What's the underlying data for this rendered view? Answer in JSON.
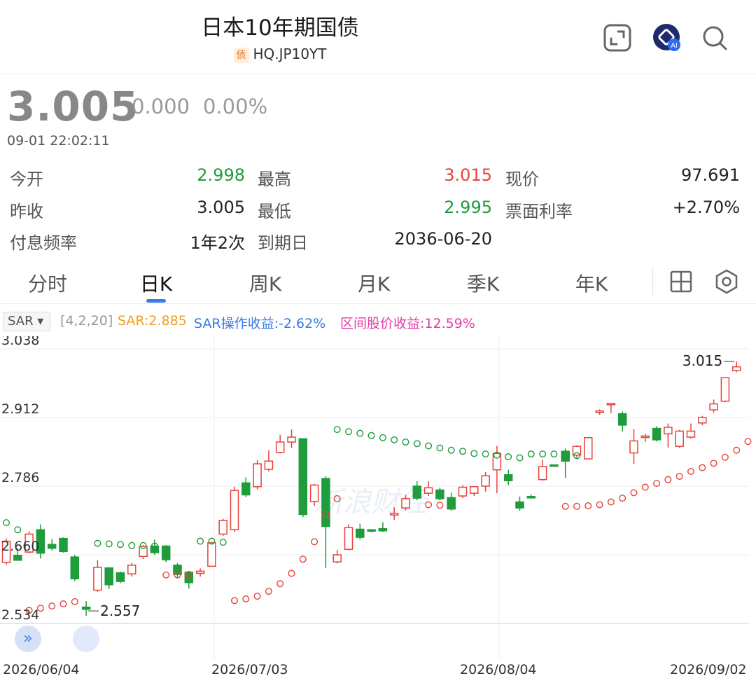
{
  "header": {
    "title": "日本10年期国债",
    "bond_tag": "债",
    "code": "HQ.JP10YT",
    "icons": [
      "expand-icon",
      "ai-assistant-icon",
      "search-icon"
    ]
  },
  "quote": {
    "price": "3.005",
    "change": "0.000",
    "change_pct": "0.00%",
    "timestamp": "09-01 22:02:11",
    "rows": [
      [
        {
          "label": "今开",
          "value": "2.998"
        },
        {
          "label": "最高",
          "value": "3.015"
        },
        {
          "label": "现价",
          "value": "97.691"
        }
      ],
      [
        {
          "label": "昨收",
          "value": "3.005"
        },
        {
          "label": "最低",
          "value": "2.995"
        },
        {
          "label": "票面利率",
          "value": "+2.70%"
        }
      ],
      [
        {
          "label": "付息频率",
          "value": "1年2次"
        },
        {
          "label": "到期日",
          "value": "2036-06-20"
        }
      ]
    ]
  },
  "tabs": [
    "分时",
    "日K",
    "周K",
    "月K",
    "季K",
    "年K"
  ],
  "active_tab": "日K",
  "indicator": {
    "name": "SAR ▾",
    "params": "[4,2,20]",
    "sar": "SAR:2.885",
    "op_return": "SAR操作收益:-2.62%",
    "range_return": "区间股价收益:12.59%"
  },
  "colors": {
    "up": "#e8423b",
    "down": "#1f9c3b",
    "sar_up": "#e8423b",
    "sar_down": "#1f9c3b"
  },
  "chart_data": {
    "type": "candlestick",
    "y_ticks": [
      "3.038",
      "2.912",
      "2.786",
      "2.660",
      "2.534"
    ],
    "ylim": [
      2.534,
      3.038
    ],
    "x_labels": [
      "2026/06/04",
      "2026/07/03",
      "2026/08/04",
      "2026/09/02"
    ],
    "max_label": "3.015",
    "min_label": "2.557",
    "watermark": "新浪财经",
    "candles": [
      {
        "o": 2.646,
        "h": 2.69,
        "l": 2.642,
        "c": 2.685
      },
      {
        "o": 2.659,
        "h": 2.672,
        "l": 2.65,
        "c": 2.65
      },
      {
        "o": 2.665,
        "h": 2.703,
        "l": 2.663,
        "c": 2.698
      },
      {
        "o": 2.706,
        "h": 2.716,
        "l": 2.653,
        "c": 2.663
      },
      {
        "o": 2.679,
        "h": 2.689,
        "l": 2.668,
        "c": 2.672
      },
      {
        "o": 2.69,
        "h": 2.692,
        "l": 2.664,
        "c": 2.666
      },
      {
        "o": 2.656,
        "h": 2.66,
        "l": 2.612,
        "c": 2.616
      },
      {
        "o": 2.564,
        "h": 2.575,
        "l": 2.548,
        "c": 2.56
      },
      {
        "o": 2.595,
        "h": 2.65,
        "l": 2.592,
        "c": 2.637
      },
      {
        "o": 2.636,
        "h": 2.637,
        "l": 2.597,
        "c": 2.605
      },
      {
        "o": 2.627,
        "h": 2.629,
        "l": 2.608,
        "c": 2.611
      },
      {
        "o": 2.625,
        "h": 2.645,
        "l": 2.62,
        "c": 2.641
      },
      {
        "o": 2.657,
        "h": 2.678,
        "l": 2.652,
        "c": 2.675
      },
      {
        "o": 2.676,
        "h": 2.688,
        "l": 2.66,
        "c": 2.664
      },
      {
        "o": 2.676,
        "h": 2.678,
        "l": 2.647,
        "c": 2.651
      },
      {
        "o": 2.641,
        "h": 2.645,
        "l": 2.617,
        "c": 2.624
      },
      {
        "o": 2.628,
        "h": 2.629,
        "l": 2.598,
        "c": 2.609
      },
      {
        "o": 2.626,
        "h": 2.635,
        "l": 2.62,
        "c": 2.63
      },
      {
        "o": 2.639,
        "h": 2.684,
        "l": 2.638,
        "c": 2.682
      },
      {
        "o": 2.698,
        "h": 2.726,
        "l": 2.695,
        "c": 2.723
      },
      {
        "o": 2.706,
        "h": 2.785,
        "l": 2.702,
        "c": 2.778
      },
      {
        "o": 2.792,
        "h": 2.802,
        "l": 2.766,
        "c": 2.77
      },
      {
        "o": 2.785,
        "h": 2.834,
        "l": 2.78,
        "c": 2.827
      },
      {
        "o": 2.817,
        "h": 2.852,
        "l": 2.813,
        "c": 2.832
      },
      {
        "o": 2.848,
        "h": 2.88,
        "l": 2.846,
        "c": 2.867
      },
      {
        "o": 2.867,
        "h": 2.89,
        "l": 2.856,
        "c": 2.876
      },
      {
        "o": 2.873,
        "h": 2.874,
        "l": 2.729,
        "c": 2.734
      },
      {
        "o": 2.758,
        "h": 2.79,
        "l": 2.75,
        "c": 2.788
      },
      {
        "o": 2.8,
        "h": 2.804,
        "l": 2.636,
        "c": 2.712
      },
      {
        "o": 2.647,
        "h": 2.669,
        "l": 2.644,
        "c": 2.66
      },
      {
        "o": 2.67,
        "h": 2.716,
        "l": 2.668,
        "c": 2.71
      },
      {
        "o": 2.707,
        "h": 2.717,
        "l": 2.688,
        "c": 2.692
      },
      {
        "o": 2.706,
        "h": 2.707,
        "l": 2.701,
        "c": 2.705
      },
      {
        "o": 2.708,
        "h": 2.72,
        "l": 2.702,
        "c": 2.704
      },
      {
        "o": 2.733,
        "h": 2.747,
        "l": 2.724,
        "c": 2.736
      },
      {
        "o": 2.746,
        "h": 2.77,
        "l": 2.742,
        "c": 2.763
      },
      {
        "o": 2.786,
        "h": 2.795,
        "l": 2.76,
        "c": 2.764
      },
      {
        "o": 2.773,
        "h": 2.795,
        "l": 2.768,
        "c": 2.783
      },
      {
        "o": 2.779,
        "h": 2.783,
        "l": 2.76,
        "c": 2.763
      },
      {
        "o": 2.765,
        "h": 2.774,
        "l": 2.741,
        "c": 2.744
      },
      {
        "o": 2.768,
        "h": 2.788,
        "l": 2.764,
        "c": 2.784
      },
      {
        "o": 2.773,
        "h": 2.78,
        "l": 2.768,
        "c": 2.785
      },
      {
        "o": 2.786,
        "h": 2.812,
        "l": 2.776,
        "c": 2.805
      },
      {
        "o": 2.816,
        "h": 2.86,
        "l": 2.773,
        "c": 2.846
      },
      {
        "o": 2.807,
        "h": 2.816,
        "l": 2.788,
        "c": 2.796
      },
      {
        "o": 2.757,
        "h": 2.767,
        "l": 2.741,
        "c": 2.746
      },
      {
        "o": 2.767,
        "h": 2.771,
        "l": 2.763,
        "c": 2.766
      },
      {
        "o": 2.798,
        "h": 2.835,
        "l": 2.796,
        "c": 2.822
      },
      {
        "o": 2.825,
        "h": 2.826,
        "l": 2.822,
        "c": 2.823
      },
      {
        "o": 2.85,
        "h": 2.855,
        "l": 2.801,
        "c": 2.832
      },
      {
        "o": 2.843,
        "h": 2.861,
        "l": 2.838,
        "c": 2.859
      },
      {
        "o": 2.836,
        "h": 2.874,
        "l": 2.835,
        "c": 2.875
      },
      {
        "o": 2.922,
        "h": 2.927,
        "l": 2.917,
        "c": 2.924
      },
      {
        "o": 2.938,
        "h": 2.939,
        "l": 2.92,
        "c": 2.938
      },
      {
        "o": 2.919,
        "h": 2.923,
        "l": 2.886,
        "c": 2.898
      },
      {
        "o": 2.847,
        "h": 2.891,
        "l": 2.827,
        "c": 2.869
      },
      {
        "o": 2.878,
        "h": 2.882,
        "l": 2.867,
        "c": 2.878
      },
      {
        "o": 2.892,
        "h": 2.896,
        "l": 2.868,
        "c": 2.871
      },
      {
        "o": 2.882,
        "h": 2.901,
        "l": 2.857,
        "c": 2.894
      },
      {
        "o": 2.859,
        "h": 2.889,
        "l": 2.856,
        "c": 2.887
      },
      {
        "o": 2.876,
        "h": 2.901,
        "l": 2.873,
        "c": 2.887
      },
      {
        "o": 2.902,
        "h": 2.915,
        "l": 2.898,
        "c": 2.912
      },
      {
        "o": 2.926,
        "h": 2.945,
        "l": 2.921,
        "c": 2.937
      },
      {
        "o": 2.942,
        "h": 2.985,
        "l": 2.94,
        "c": 2.985
      },
      {
        "o": 2.998,
        "h": 3.015,
        "l": 2.995,
        "c": 3.005
      }
    ],
    "sar_up": [
      {
        "i": 2,
        "v": 2.558
      },
      {
        "i": 3,
        "v": 2.562
      },
      {
        "i": 4,
        "v": 2.566
      },
      {
        "i": 5,
        "v": 2.57
      },
      {
        "i": 6,
        "v": 2.574
      },
      {
        "i": 14,
        "v": 2.623
      },
      {
        "i": 15,
        "v": 2.623
      },
      {
        "i": 16,
        "v": 2.624
      },
      {
        "i": 20,
        "v": 2.576
      },
      {
        "i": 21,
        "v": 2.579
      },
      {
        "i": 22,
        "v": 2.584
      },
      {
        "i": 23,
        "v": 2.593
      },
      {
        "i": 24,
        "v": 2.607
      },
      {
        "i": 25,
        "v": 2.626
      },
      {
        "i": 26,
        "v": 2.652
      },
      {
        "i": 27,
        "v": 2.684
      },
      {
        "i": 28,
        "v": 2.734
      },
      {
        "i": 29,
        "v": 2.763
      },
      {
        "i": 37,
        "v": 2.752
      },
      {
        "i": 38,
        "v": 2.751
      },
      {
        "i": 49,
        "v": 2.749
      },
      {
        "i": 50,
        "v": 2.749
      },
      {
        "i": 51,
        "v": 2.75
      },
      {
        "i": 52,
        "v": 2.752
      },
      {
        "i": 53,
        "v": 2.757
      },
      {
        "i": 54,
        "v": 2.764
      },
      {
        "i": 55,
        "v": 2.774
      },
      {
        "i": 56,
        "v": 2.784
      },
      {
        "i": 57,
        "v": 2.791
      },
      {
        "i": 58,
        "v": 2.798
      },
      {
        "i": 59,
        "v": 2.804
      },
      {
        "i": 60,
        "v": 2.813
      },
      {
        "i": 61,
        "v": 2.82
      },
      {
        "i": 62,
        "v": 2.828
      },
      {
        "i": 63,
        "v": 2.839
      },
      {
        "i": 64,
        "v": 2.852
      },
      {
        "i": 65,
        "v": 2.868
      }
    ],
    "sar_down": [
      {
        "i": 0,
        "v": 2.719
      },
      {
        "i": 1,
        "v": 2.706
      },
      {
        "i": 8,
        "v": 2.681
      },
      {
        "i": 9,
        "v": 2.68
      },
      {
        "i": 10,
        "v": 2.679
      },
      {
        "i": 11,
        "v": 2.677
      },
      {
        "i": 12,
        "v": 2.677
      },
      {
        "i": 13,
        "v": 2.676
      },
      {
        "i": 17,
        "v": 2.685
      },
      {
        "i": 18,
        "v": 2.685
      },
      {
        "i": 19,
        "v": 2.683
      },
      {
        "i": 29,
        "v": 2.89
      },
      {
        "i": 30,
        "v": 2.886
      },
      {
        "i": 31,
        "v": 2.883
      },
      {
        "i": 32,
        "v": 2.879
      },
      {
        "i": 33,
        "v": 2.875
      },
      {
        "i": 34,
        "v": 2.871
      },
      {
        "i": 35,
        "v": 2.867
      },
      {
        "i": 36,
        "v": 2.864
      },
      {
        "i": 37,
        "v": 2.86
      },
      {
        "i": 38,
        "v": 2.856
      },
      {
        "i": 39,
        "v": 2.852
      },
      {
        "i": 40,
        "v": 2.85
      },
      {
        "i": 41,
        "v": 2.846
      },
      {
        "i": 42,
        "v": 2.845
      },
      {
        "i": 43,
        "v": 2.843
      },
      {
        "i": 44,
        "v": 2.84
      },
      {
        "i": 45,
        "v": 2.838
      },
      {
        "i": 46,
        "v": 2.845
      },
      {
        "i": 47,
        "v": 2.845
      },
      {
        "i": 48,
        "v": 2.845
      },
      {
        "i": 49,
        "v": 2.845
      },
      {
        "i": 50,
        "v": 2.842
      }
    ]
  }
}
